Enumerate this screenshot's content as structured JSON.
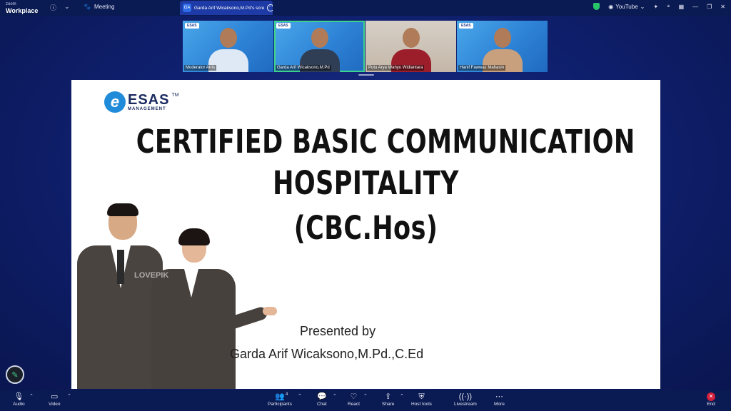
{
  "app": {
    "logo_line1": "zoom",
    "logo_line2": "Workplace"
  },
  "titlebar": {
    "meeting_label": "Meeting",
    "tab_avatar": "GA",
    "tab_title": "Garda Arif Wicaksono,M.Pd's scre",
    "youtube_label": "YouTube"
  },
  "participants": [
    {
      "name": "Moderator Arris",
      "brand": "ESAS"
    },
    {
      "name": "Garda Arif Wicaksono,M.Pd",
      "brand": "ESAS"
    },
    {
      "name": "Putu Arya Wahyu Widiantara",
      "brand": ""
    },
    {
      "name": "Hanif Fawwaz Mahasin",
      "brand": "ESAS"
    }
  ],
  "slide": {
    "logo_text": "ESAS",
    "logo_sub": "MANAGEMENT",
    "logo_tm": "TM",
    "logo_letter": "e",
    "watermark": "LOVEPIK",
    "title_line1": "CERTIFIED BASIC COMMUNICATION",
    "title_line2": "HOSPITALITY",
    "title_line3": "(CBC.Hos)",
    "presented_by": "Presented by",
    "presenter": "Garda Arif Wicaksono,M.Pd.,C.Ed"
  },
  "toolbar": {
    "audio": "Audio",
    "video": "Video",
    "participants": "Participants",
    "participants_count": "4",
    "chat": "Chat",
    "react": "React",
    "share": "Share",
    "host_tools": "Host tools",
    "livestream": "Livestream",
    "more": "More",
    "end": "End"
  },
  "colors": {
    "accent_green": "#3ed38b",
    "end_red": "#d21f3c",
    "stage_blue": "#0f2070"
  }
}
